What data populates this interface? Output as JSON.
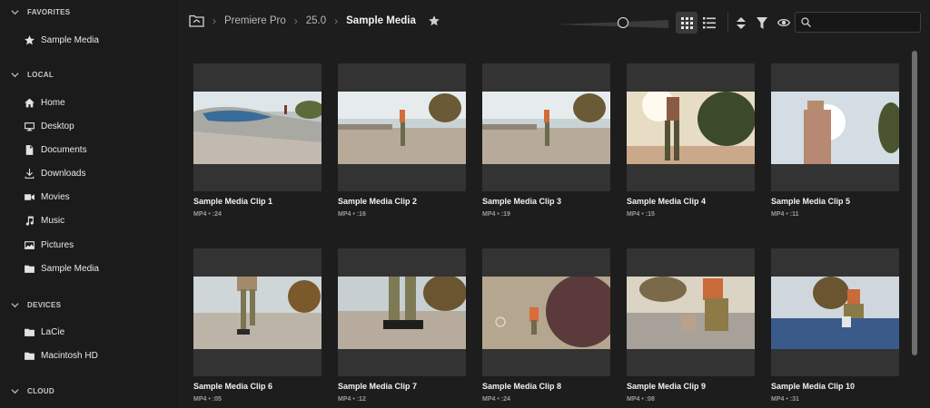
{
  "sidebar": {
    "favorites_header": "FAVORITES",
    "favorites": [
      {
        "label": "Sample Media",
        "icon": "star-icon"
      }
    ],
    "local_header": "LOCAL",
    "local": [
      {
        "label": "Home",
        "icon": "home-icon"
      },
      {
        "label": "Desktop",
        "icon": "monitor-icon"
      },
      {
        "label": "Documents",
        "icon": "document-icon"
      },
      {
        "label": "Downloads",
        "icon": "download-icon"
      },
      {
        "label": "Movies",
        "icon": "video-camera-icon"
      },
      {
        "label": "Music",
        "icon": "music-note-icon"
      },
      {
        "label": "Pictures",
        "icon": "image-icon"
      },
      {
        "label": "Sample Media",
        "icon": "folder-icon"
      }
    ],
    "devices_header": "DEVICES",
    "devices": [
      {
        "label": "LaCie",
        "icon": "folder-icon"
      },
      {
        "label": "Macintosh HD",
        "icon": "folder-icon"
      }
    ],
    "cloud_header": "CLOUD"
  },
  "breadcrumb": {
    "items": [
      "Premiere Pro",
      "25.0"
    ],
    "current": "Sample Media"
  },
  "toolbar": {
    "zoom_level": 0.6,
    "view_mode": "grid",
    "search_placeholder": ""
  },
  "clips": [
    {
      "title": "Sample Media Clip 1",
      "meta": "MP4  •  :24",
      "scene": "skatepark-bowl"
    },
    {
      "title": "Sample Media Clip 2",
      "meta": "MP4  •  :16",
      "scene": "skater-standing"
    },
    {
      "title": "Sample Media Clip 3",
      "meta": "MP4  •  :19",
      "scene": "skater-standing"
    },
    {
      "title": "Sample Media Clip 4",
      "meta": "MP4  •  :15",
      "scene": "sun-silhouette"
    },
    {
      "title": "Sample Media Clip 5",
      "meta": "MP4  •  :11",
      "scene": "bright-sky"
    },
    {
      "title": "Sample Media Clip 6",
      "meta": "MP4  •  :05",
      "scene": "legs-walking"
    },
    {
      "title": "Sample Media Clip 7",
      "meta": "MP4  •  :12",
      "scene": "legs-closeup"
    },
    {
      "title": "Sample Media Clip 8",
      "meta": "MP4  •  :24",
      "scene": "ground-tree"
    },
    {
      "title": "Sample Media Clip 9",
      "meta": "MP4  •  :08",
      "scene": "sitting-skate"
    },
    {
      "title": "Sample Media Clip 10",
      "meta": "MP4  •  :31",
      "scene": "ledge-sitting"
    }
  ],
  "colors": {
    "background": "#1d1d1d",
    "card": "#333333",
    "accent_selected": "#3a3a3a"
  }
}
